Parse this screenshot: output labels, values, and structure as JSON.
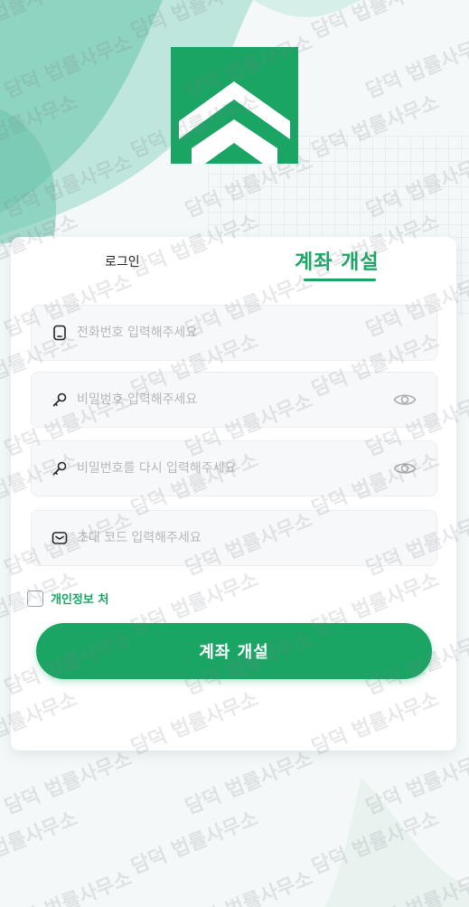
{
  "tabs": {
    "login": "로그인",
    "signup": "계좌 개설"
  },
  "form": {
    "phone_placeholder": "전화번호 입력해주세요",
    "password_placeholder": "비밀번호 입력해주세요",
    "password_confirm_placeholder": "비밀번호를 다시 입력해주세요",
    "invite_placeholder": "초대 코드 입력해주세요",
    "agree_label": "개인정보 처",
    "submit_label": "계좌 개설"
  },
  "watermark": "담덕 법률사무소",
  "colors": {
    "accent": "#1aa564",
    "background_teal": "#9fd9c9"
  },
  "icons": [
    "phone-icon",
    "key-icon",
    "eye-icon",
    "mail-icon",
    "logo-chevron"
  ]
}
